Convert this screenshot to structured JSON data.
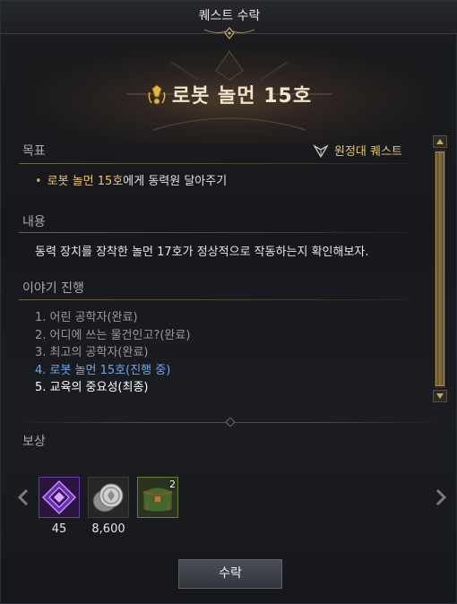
{
  "window": {
    "title": "퀘스트 수락"
  },
  "quest": {
    "title": "로봇 놀먼 15호"
  },
  "objective": {
    "label": "목표",
    "badge": "원정대 퀘스트",
    "bullet": "•",
    "item_highlight": "로봇 놀먼 15호",
    "item_rest": "에게 동력원 달아주기"
  },
  "content": {
    "label": "내용",
    "text": "동력 장치를 장착한 놀먼 17호가 정상적으로 작동하는지 확인해보자."
  },
  "story": {
    "label": "이야기 진행",
    "steps": [
      "1. 어린 공학자(완료)",
      "2. 어디에 쓰는 물건인고?(완료)",
      "3. 최고의 공학자(완료)",
      "4. 로봇 놀먼 15호(진행 중)",
      "5. 교육의 중요성(최종)"
    ]
  },
  "reward": {
    "label": "보상",
    "items": [
      {
        "icon": "purple-crystal-icon",
        "count": "45"
      },
      {
        "icon": "silver-coin-icon",
        "count": "8,600"
      },
      {
        "icon": "green-bag-icon",
        "badge": "2"
      }
    ]
  },
  "accept_label": "수락",
  "colors": {
    "highlight": "#e8c36a",
    "in_progress": "#6fa8e8",
    "completed": "#9a9a9a",
    "gold_border": "#b69250"
  }
}
